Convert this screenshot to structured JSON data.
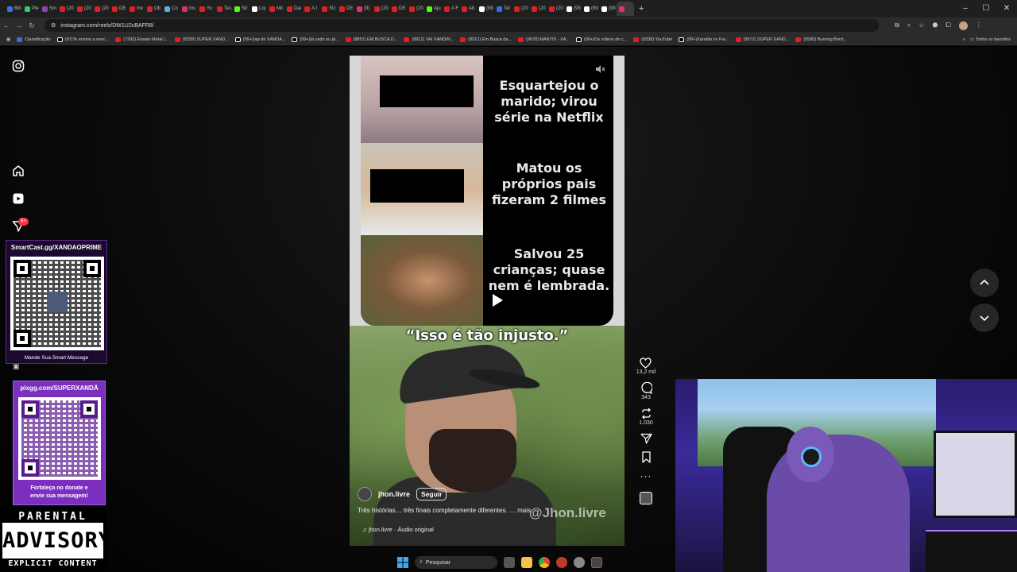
{
  "browser": {
    "tabs": [
      {
        "label": "Bib",
        "color": "#3a6ee8"
      },
      {
        "label": "Ple",
        "color": "#2ecc71"
      },
      {
        "label": "Sm",
        "color": "#8e44ad"
      },
      {
        "label": "(20",
        "color": "#e02020"
      },
      {
        "label": "(20",
        "color": "#e02020"
      },
      {
        "label": "(20",
        "color": "#e02020"
      },
      {
        "label": "DE",
        "color": "#e02020"
      },
      {
        "label": "Inv",
        "color": "#e02020"
      },
      {
        "label": "Ob",
        "color": "#e02020"
      },
      {
        "label": "Co",
        "color": "#5dade2"
      },
      {
        "label": "Ins",
        "color": "#e1306c"
      },
      {
        "label": "Yo",
        "color": "#e02020"
      },
      {
        "label": "Tes",
        "color": "#e02020"
      },
      {
        "label": "Str",
        "color": "#53fc18"
      },
      {
        "label": "Loj",
        "color": "#ffffff"
      },
      {
        "label": "Mil",
        "color": "#e02020"
      },
      {
        "label": "Dai",
        "color": "#e02020"
      },
      {
        "label": "A I",
        "color": "#e02020"
      },
      {
        "label": "SU",
        "color": "#e02020"
      },
      {
        "label": "DE",
        "color": "#e02020"
      },
      {
        "label": "(9)",
        "color": "#e1306c"
      },
      {
        "label": "(20",
        "color": "#e02020"
      },
      {
        "label": "DE",
        "color": "#e02020"
      },
      {
        "label": "(20",
        "color": "#e02020"
      },
      {
        "label": "Aju",
        "color": "#53fc18"
      },
      {
        "label": "A F",
        "color": "#e02020"
      },
      {
        "label": "Ab",
        "color": "#e02020"
      },
      {
        "label": "(99",
        "color": "#ffffff"
      },
      {
        "label": "Tel",
        "color": "#3a6ee8"
      },
      {
        "label": "(20",
        "color": "#e02020"
      },
      {
        "label": "(20",
        "color": "#e02020"
      },
      {
        "label": "(20",
        "color": "#e02020"
      },
      {
        "label": "(99",
        "color": "#ffffff"
      },
      {
        "label": "(99",
        "color": "#ffffff"
      },
      {
        "label": "(99",
        "color": "#ffffff"
      },
      {
        "label": "",
        "color": "#e1306c"
      }
    ],
    "new_tab": "+",
    "window_controls": [
      "–",
      "☐",
      "✕"
    ],
    "url": "instagram.com/reels/DW1U2cBAFR8/",
    "bookmarks": [
      {
        "label": "Classificação",
        "kind": "bl"
      },
      {
        "label": "(97)Te ensino a venc...",
        "kind": "tk"
      },
      {
        "label": "(7292) Ensaio Metal |...",
        "kind": "yt"
      },
      {
        "label": "(8159) SUPER XAND...",
        "kind": "yt"
      },
      {
        "label": "(99+)rap do XANDÃ...",
        "kind": "tk"
      },
      {
        "label": "(99+)tá cedo ou já...",
        "kind": "tk"
      },
      {
        "label": "(8851) EM BUSCA D...",
        "kind": "yt"
      },
      {
        "label": "(8912) VAI XANDIN...",
        "kind": "yt"
      },
      {
        "label": "(8912) Em Busca da...",
        "kind": "yt"
      },
      {
        "label": "(9078) MANTIS - XA...",
        "kind": "yt"
      },
      {
        "label": "(99+)Os vídeos de c...",
        "kind": "tk"
      },
      {
        "label": "(9338) YouTube",
        "kind": "yt"
      },
      {
        "label": "(99+)Xandão vs Fra...",
        "kind": "tk"
      },
      {
        "label": "(9572) SUPER XAND...",
        "kind": "yt"
      },
      {
        "label": "(9580) Burning Bord...",
        "kind": "yt"
      }
    ],
    "bookmarks_more": "»",
    "all_bookmarks": "Todos os favoritos"
  },
  "sidebar": {
    "notification_badge": "9+"
  },
  "overlays": {
    "qr1_title": "SmartCast.gg/XANDAOPRIME",
    "qr1_caption": "Mande Sua Smart Message",
    "qr2_title": "pixgg.com/SUPERXANDÃ",
    "qr2_caption_line1": "Fortaleça no donate e",
    "qr2_caption_line2": "envie sua mensagem!",
    "advisory_line1": "PARENTAL",
    "advisory_line2": "ADVISORY",
    "advisory_line3": "EXPLICIT CONTENT"
  },
  "reel": {
    "caption1": "Esquartejou o marido; virou série na Netflix",
    "caption2": "Matou os próprios pais fizeram 2 filmes",
    "caption3": "Salvou 25 crianças; quase nem é lembrada.",
    "subtitle": "“Isso é tão injusto.”",
    "author": "jhon.livre",
    "follow_label": "Seguir",
    "description": "Três histórias… três finais completamente diferentes. … mais",
    "watermark": "@Jhon.livre",
    "audio": "jhon.livre · Áudio original"
  },
  "actions": {
    "likes": "13,2 mil",
    "comments": "343",
    "reposts": "1.030"
  },
  "taskbar": {
    "search_placeholder": "Pesquisar"
  }
}
